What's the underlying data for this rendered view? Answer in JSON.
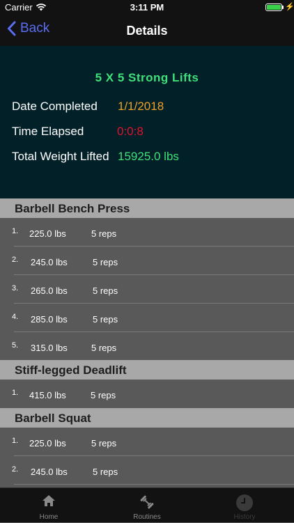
{
  "status_bar": {
    "carrier": "Carrier",
    "time": "3:11 PM"
  },
  "nav": {
    "back_label": "Back",
    "title": "Details"
  },
  "summary": {
    "routine_name": "5 X 5 Strong Lifts",
    "date_label": "Date Completed",
    "date_value": "1/1/2018",
    "time_label": "Time Elapsed",
    "time_value": "0:0:8",
    "weight_label": "Total Weight Lifted",
    "weight_value": "15925.0 lbs"
  },
  "exercises": [
    {
      "name": "Barbell Bench Press",
      "sets": [
        {
          "num": "1.",
          "weight": "225.0 lbs",
          "reps": "5 reps"
        },
        {
          "num": "2.",
          "weight": "245.0 lbs",
          "reps": "5 reps"
        },
        {
          "num": "3.",
          "weight": "265.0 lbs",
          "reps": "5 reps"
        },
        {
          "num": "4.",
          "weight": "285.0 lbs",
          "reps": "5 reps"
        },
        {
          "num": "5.",
          "weight": "315.0 lbs",
          "reps": "5 reps"
        }
      ]
    },
    {
      "name": "Stiff-legged Deadlift",
      "sets": [
        {
          "num": "1.",
          "weight": "415.0 lbs",
          "reps": "5 reps"
        }
      ]
    },
    {
      "name": "Barbell Squat",
      "sets": [
        {
          "num": "1.",
          "weight": "225.0 lbs",
          "reps": "5 reps"
        },
        {
          "num": "2.",
          "weight": "245.0 lbs",
          "reps": "5 reps"
        }
      ]
    }
  ],
  "tabs": [
    {
      "label": "Home",
      "icon": "home-icon",
      "active": false
    },
    {
      "label": "Routines",
      "icon": "dumbbell-icon",
      "active": false
    },
    {
      "label": "History",
      "icon": "clock-icon",
      "active": true
    }
  ],
  "colors": {
    "accent_blue": "#5b6df0",
    "routine_green": "#3fe07a",
    "date_orange": "#f0a326",
    "time_red": "#e1132e",
    "summary_bg": "#022028",
    "list_bg": "#595959",
    "section_header_bg": "#a8a8a8"
  }
}
